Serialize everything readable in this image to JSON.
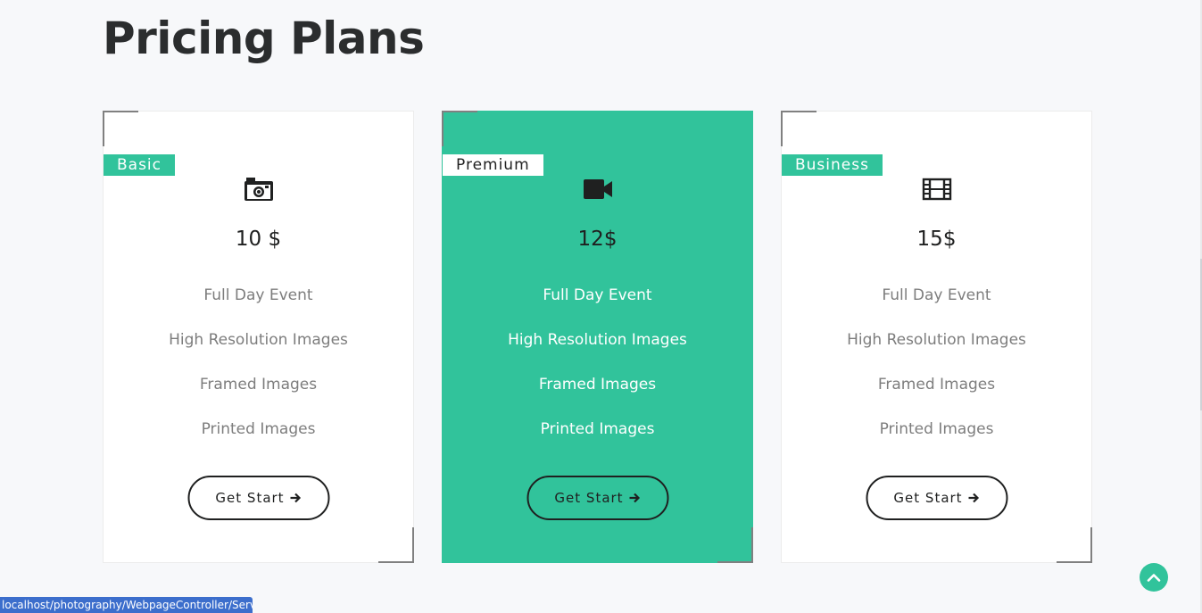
{
  "page": {
    "title": "Pricing Plans"
  },
  "plans": [
    {
      "tier": "Basic",
      "icon": "camera-icon",
      "price": "10 $",
      "features": [
        "Full Day Event",
        "High Resolution Images",
        "Framed Images",
        "Printed Images"
      ],
      "cta": "Get Start"
    },
    {
      "tier": "Premium",
      "icon": "video-camera-icon",
      "price": "12$",
      "features": [
        "Full Day Event",
        "High Resolution Images",
        "Framed Images",
        "Printed Images"
      ],
      "cta": "Get Start"
    },
    {
      "tier": "Business",
      "icon": "film-icon",
      "price": "15$",
      "features": [
        "Full Day Event",
        "High Resolution Images",
        "Framed Images",
        "Printed Images"
      ],
      "cta": "Get Start"
    }
  ],
  "status_bar": {
    "url": "localhost/photography/WebpageController/Services"
  },
  "colors": {
    "accent": "#31c39b",
    "text_dark": "#2b2d2e",
    "text_muted": "#7d7d7d",
    "status_bar": "#3c6ecc"
  }
}
